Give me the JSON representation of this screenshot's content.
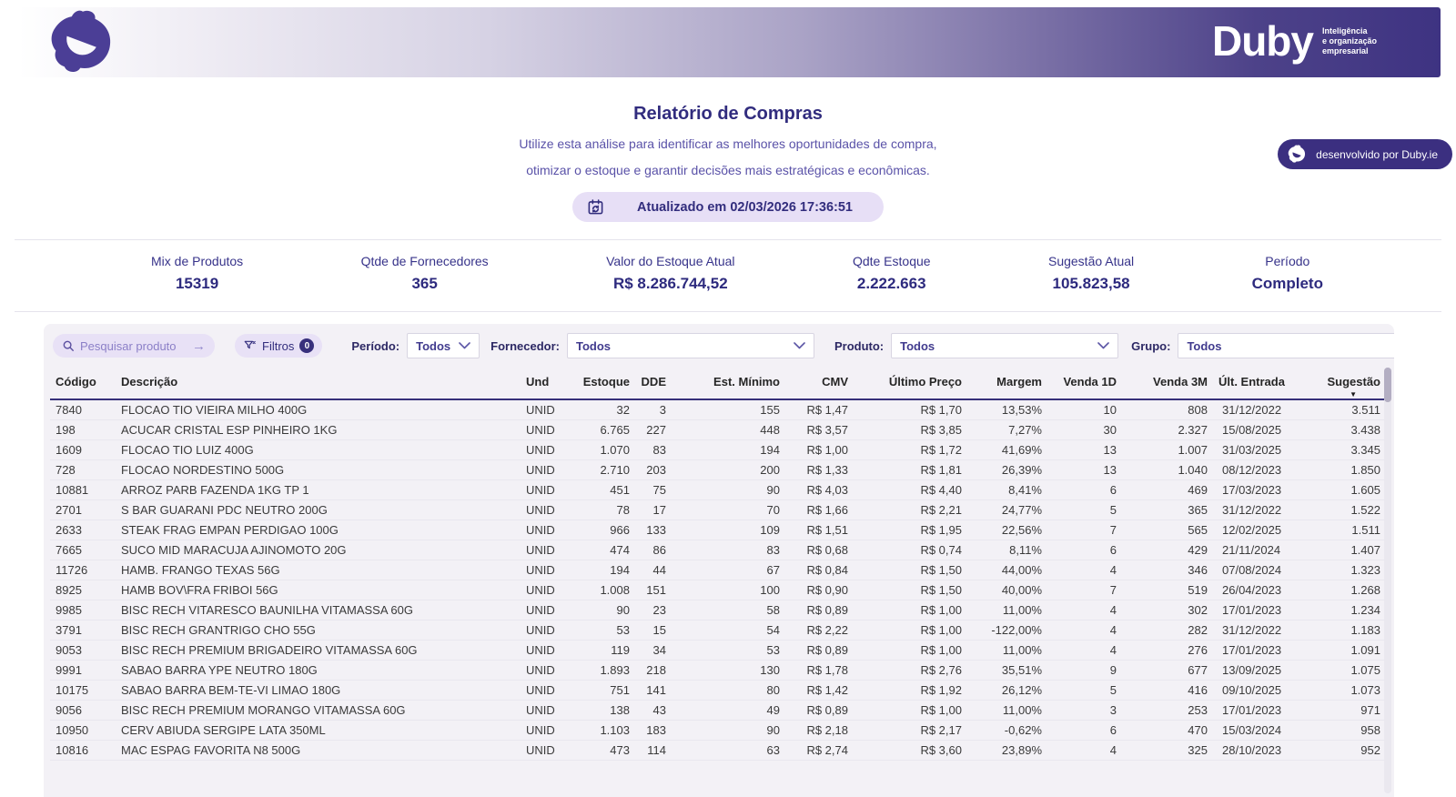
{
  "brand": {
    "name": "Duby",
    "tagline_lines": [
      "Inteligência",
      "e organização",
      "empresarial"
    ],
    "dev_badge": "desenvolvido por Duby.ie"
  },
  "header": {
    "title": "Relatório de Compras",
    "subtitle_line1": "Utilize esta análise para identificar as melhores oportunidades de compra,",
    "subtitle_line2": "otimizar o estoque e garantir decisões mais estratégicas e econômicas.",
    "updated_badge": "Atualizado em 02/03/2026 17:36:51"
  },
  "stats": [
    {
      "label": "Mix de Produtos",
      "value": "15319"
    },
    {
      "label": "Qtde de Fornecedores",
      "value": "365"
    },
    {
      "label": "Valor do Estoque Atual",
      "value": "R$ 8.286.744,52"
    },
    {
      "label": "Qdte Estoque",
      "value": "2.222.663"
    },
    {
      "label": "Sugestão Atual",
      "value": "105.823,58"
    },
    {
      "label": "Período",
      "value": "Completo"
    }
  ],
  "filters": {
    "search_placeholder": "Pesquisar produto",
    "filters_label": "Filtros",
    "filters_count": "0",
    "dropdowns": [
      {
        "label": "Período:",
        "value": "Todos"
      },
      {
        "label": "Fornecedor:",
        "value": "Todos"
      },
      {
        "label": "Produto:",
        "value": "Todos"
      },
      {
        "label": "Grupo:",
        "value": "Todos"
      }
    ]
  },
  "table": {
    "columns": [
      "Código",
      "Descrição",
      "Und",
      "Estoque",
      "DDE",
      "Est. Mínimo",
      "CMV",
      "Último Preço",
      "Margem",
      "Venda 1D",
      "Venda 3M",
      "Últ. Entrada",
      "Sugestão"
    ],
    "rows": [
      [
        "7840",
        "FLOCAO TIO VIEIRA MILHO 400G",
        "UNID",
        "32",
        "3",
        "155",
        "R$ 1,47",
        "R$ 1,70",
        "13,53%",
        "10",
        "808",
        "31/12/2022",
        "3.511"
      ],
      [
        "198",
        "ACUCAR CRISTAL ESP PINHEIRO 1KG",
        "UNID",
        "6.765",
        "227",
        "448",
        "R$ 3,57",
        "R$ 3,85",
        "7,27%",
        "30",
        "2.327",
        "15/08/2025",
        "3.438"
      ],
      [
        "1609",
        "FLOCAO TIO LUIZ 400G",
        "UNID",
        "1.070",
        "83",
        "194",
        "R$ 1,00",
        "R$ 1,72",
        "41,69%",
        "13",
        "1.007",
        "31/03/2025",
        "3.345"
      ],
      [
        "728",
        "FLOCAO NORDESTINO 500G",
        "UNID",
        "2.710",
        "203",
        "200",
        "R$ 1,33",
        "R$ 1,81",
        "26,39%",
        "13",
        "1.040",
        "08/12/2023",
        "1.850"
      ],
      [
        "10881",
        "ARROZ PARB FAZENDA 1KG TP 1",
        "UNID",
        "451",
        "75",
        "90",
        "R$ 4,03",
        "R$ 4,40",
        "8,41%",
        "6",
        "469",
        "17/03/2023",
        "1.605"
      ],
      [
        "2701",
        "S BAR GUARANI PDC NEUTRO 200G",
        "UNID",
        "78",
        "17",
        "70",
        "R$ 1,66",
        "R$ 2,21",
        "24,77%",
        "5",
        "365",
        "31/12/2022",
        "1.522"
      ],
      [
        "2633",
        "STEAK FRAG EMPAN PERDIGAO 100G",
        "UNID",
        "966",
        "133",
        "109",
        "R$ 1,51",
        "R$ 1,95",
        "22,56%",
        "7",
        "565",
        "12/02/2025",
        "1.511"
      ],
      [
        "7665",
        "SUCO MID MARACUJA AJINOMOTO 20G",
        "UNID",
        "474",
        "86",
        "83",
        "R$ 0,68",
        "R$ 0,74",
        "8,11%",
        "6",
        "429",
        "21/11/2024",
        "1.407"
      ],
      [
        "11726",
        "HAMB. FRANGO TEXAS 56G",
        "UNID",
        "194",
        "44",
        "67",
        "R$ 0,84",
        "R$ 1,50",
        "44,00%",
        "4",
        "346",
        "07/08/2024",
        "1.323"
      ],
      [
        "8925",
        "HAMB BOV\\FRA FRIBOI 56G",
        "UNID",
        "1.008",
        "151",
        "100",
        "R$ 0,90",
        "R$ 1,50",
        "40,00%",
        "7",
        "519",
        "26/04/2023",
        "1.268"
      ],
      [
        "9985",
        "BISC RECH VITARESCO BAUNILHA VITAMASSA 60G",
        "UNID",
        "90",
        "23",
        "58",
        "R$ 0,89",
        "R$ 1,00",
        "11,00%",
        "4",
        "302",
        "17/01/2023",
        "1.234"
      ],
      [
        "3791",
        "BISC RECH GRANTRIGO CHO 55G",
        "UNID",
        "53",
        "15",
        "54",
        "R$ 2,22",
        "R$ 1,00",
        "-122,00%",
        "4",
        "282",
        "31/12/2022",
        "1.183"
      ],
      [
        "9053",
        "BISC RECH PREMIUM BRIGADEIRO VITAMASSA 60G",
        "UNID",
        "119",
        "34",
        "53",
        "R$ 0,89",
        "R$ 1,00",
        "11,00%",
        "4",
        "276",
        "17/01/2023",
        "1.091"
      ],
      [
        "9991",
        "SABAO BARRA YPE NEUTRO 180G",
        "UNID",
        "1.893",
        "218",
        "130",
        "R$ 1,78",
        "R$ 2,76",
        "35,51%",
        "9",
        "677",
        "13/09/2025",
        "1.075"
      ],
      [
        "10175",
        "SABAO BARRA BEM-TE-VI LIMAO 180G",
        "UNID",
        "751",
        "141",
        "80",
        "R$ 1,42",
        "R$ 1,92",
        "26,12%",
        "5",
        "416",
        "09/10/2025",
        "1.073"
      ],
      [
        "9056",
        "BISC RECH PREMIUM MORANGO VITAMASSA 60G",
        "UNID",
        "138",
        "43",
        "49",
        "R$ 0,89",
        "R$ 1,00",
        "11,00%",
        "3",
        "253",
        "17/01/2023",
        "971"
      ],
      [
        "10950",
        "CERV ABIUDA SERGIPE LATA 350ML",
        "UNID",
        "1.103",
        "183",
        "90",
        "R$ 2,18",
        "R$ 2,17",
        "-0,62%",
        "6",
        "470",
        "15/03/2024",
        "958"
      ],
      [
        "10816",
        "MAC ESPAG FAVORITA N8 500G",
        "UNID",
        "473",
        "114",
        "63",
        "R$ 2,74",
        "R$ 3,60",
        "23,89%",
        "4",
        "325",
        "28/10/2023",
        "952"
      ]
    ]
  },
  "colors": {
    "accent_dark": "#3b2f80",
    "logo_purple": "#4b3e96",
    "pill_bg": "#e8e1f6",
    "panel_bg": "#f3f1f6",
    "header_underline": "#36307a",
    "title_text": "#312c7e",
    "subtitle_text": "#5a52a8"
  }
}
